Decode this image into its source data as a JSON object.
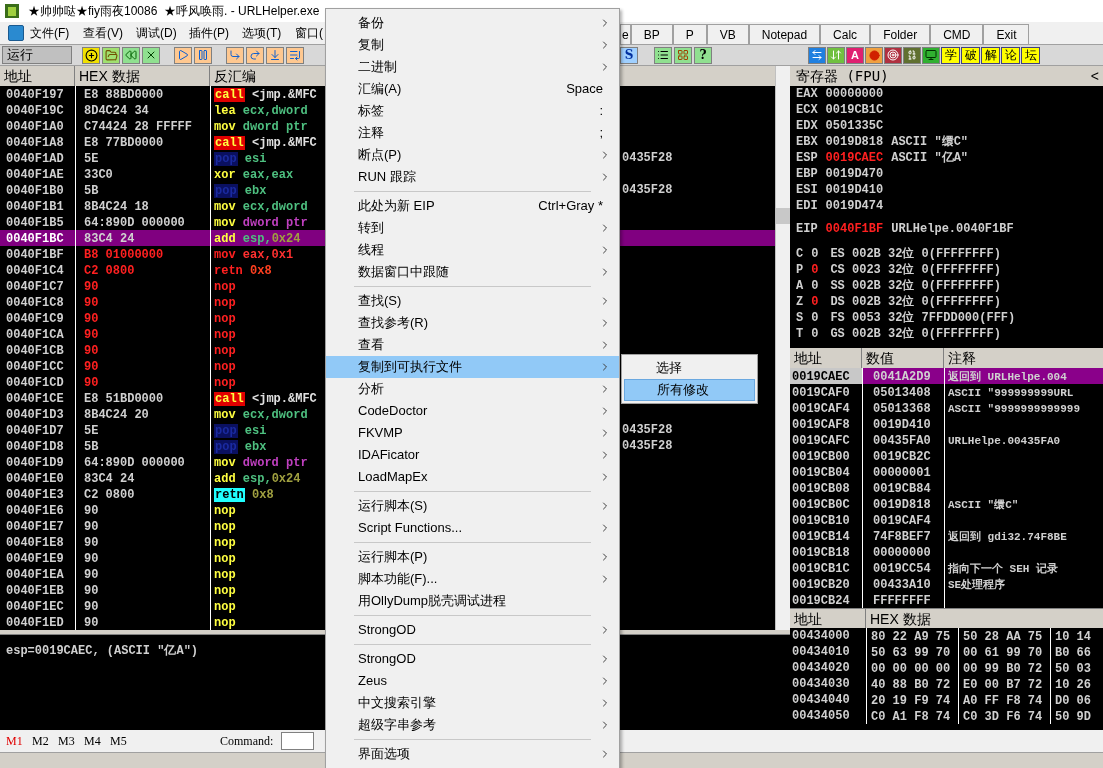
{
  "window": {
    "title": "★帅帅哒★fiy雨夜10086  ★呼风唤雨. - URLHelper.exe"
  },
  "menu_bar": [
    "文件(F)",
    "查看(V)",
    "调试(D)",
    "插件(P)",
    "选项(T)",
    "窗口("
  ],
  "tool_tabs": [
    "e",
    "BP",
    "P",
    "VB",
    "Notepad",
    "Calc",
    "Folder",
    "CMD",
    "Exit"
  ],
  "toolbar": {
    "run_label": "运行",
    "s_label": "S",
    "help_label": "?",
    "a_label": "A",
    "forum_chars": [
      "学",
      "破",
      "解",
      "论",
      "坛"
    ]
  },
  "disasm": {
    "columns": [
      "地址",
      "HEX 数据",
      "反汇编"
    ],
    "rows": [
      {
        "address": "0040F197",
        "hex": "E8 88BD0000",
        "mnemonic": "call",
        "kind": "call",
        "operands": [
          {
            "text": "<jmp.&MFC",
            "kind": "plain"
          }
        ],
        "selected": false,
        "modified": false
      },
      {
        "address": "0040F19C",
        "hex": "8D4C24 34",
        "mnemonic": "lea",
        "kind": "normal",
        "operands": [
          {
            "text": "ecx,dword",
            "kind": "reg"
          }
        ],
        "selected": false,
        "modified": false
      },
      {
        "address": "0040F1A0",
        "hex": "C74424 28 FFFFF",
        "mnemonic": "mov",
        "kind": "normal",
        "operands": [
          {
            "text": "dword ptr",
            "kind": "reg"
          }
        ],
        "selected": false,
        "modified": false
      },
      {
        "address": "0040F1A8",
        "hex": "E8 77BD0000",
        "mnemonic": "call",
        "kind": "call",
        "operands": [
          {
            "text": "<jmp.&MFC",
            "kind": "plain"
          }
        ],
        "selected": false,
        "modified": false
      },
      {
        "address": "0040F1AD",
        "hex": "5E",
        "mnemonic": "pop",
        "kind": "stack",
        "operands": [
          {
            "text": "esi",
            "kind": "reg"
          }
        ],
        "comment": "0435F28",
        "selected": false,
        "modified": false
      },
      {
        "address": "0040F1AE",
        "hex": "33C0",
        "mnemonic": "xor",
        "kind": "normal",
        "operands": [
          {
            "text": "eax,eax",
            "kind": "reg"
          }
        ],
        "selected": false,
        "modified": false
      },
      {
        "address": "0040F1B0",
        "hex": "5B",
        "mnemonic": "pop",
        "kind": "stack",
        "operands": [
          {
            "text": "ebx",
            "kind": "reg"
          }
        ],
        "comment": "0435F28",
        "selected": false,
        "modified": false
      },
      {
        "address": "0040F1B1",
        "hex": "8B4C24 18",
        "mnemonic": "mov",
        "kind": "normal",
        "operands": [
          {
            "text": "ecx,dword",
            "kind": "reg"
          }
        ],
        "selected": false,
        "modified": false
      },
      {
        "address": "0040F1B5",
        "hex": "64:890D 000000",
        "mnemonic": "mov",
        "kind": "normal",
        "operands": [
          {
            "text": "dword ptr",
            "kind": "mem"
          }
        ],
        "selected": false,
        "modified": false
      },
      {
        "address": "0040F1BC",
        "hex": "83C4 24",
        "mnemonic": "add",
        "kind": "normal",
        "operands": [
          {
            "text": "esp,",
            "kind": "reg"
          },
          {
            "text": "0x24",
            "kind": "const"
          }
        ],
        "selected": true,
        "modified": false
      },
      {
        "address": "0040F1BF",
        "hex": "B8 01000000",
        "mnemonic": "mov",
        "kind": "normal",
        "operands": [
          {
            "text": "eax,0x1",
            "kind": "reg"
          }
        ],
        "selected": false,
        "modified": true
      },
      {
        "address": "0040F1C4",
        "hex": "C2 0800",
        "mnemonic": "retn",
        "kind": "normal",
        "operands": [
          {
            "text": "0x8",
            "kind": "const"
          }
        ],
        "selected": false,
        "modified": true
      },
      {
        "address": "0040F1C7",
        "hex": "90",
        "mnemonic": "nop",
        "kind": "normal",
        "operands": [],
        "selected": false,
        "modified": true
      },
      {
        "address": "0040F1C8",
        "hex": "90",
        "mnemonic": "nop",
        "kind": "normal",
        "operands": [],
        "selected": false,
        "modified": true
      },
      {
        "address": "0040F1C9",
        "hex": "90",
        "mnemonic": "nop",
        "kind": "normal",
        "operands": [],
        "selected": false,
        "modified": true
      },
      {
        "address": "0040F1CA",
        "hex": "90",
        "mnemonic": "nop",
        "kind": "normal",
        "operands": [],
        "selected": false,
        "modified": true
      },
      {
        "address": "0040F1CB",
        "hex": "90",
        "mnemonic": "nop",
        "kind": "normal",
        "operands": [],
        "selected": false,
        "modified": true
      },
      {
        "address": "0040F1CC",
        "hex": "90",
        "mnemonic": "nop",
        "kind": "normal",
        "operands": [],
        "selected": false,
        "modified": true
      },
      {
        "address": "0040F1CD",
        "hex": "90",
        "mnemonic": "nop",
        "kind": "normal",
        "operands": [],
        "selected": false,
        "modified": true
      },
      {
        "address": "0040F1CE",
        "hex": "E8 51BD0000",
        "mnemonic": "call",
        "kind": "call",
        "operands": [
          {
            "text": "<jmp.&MFC",
            "kind": "plain"
          }
        ],
        "selected": false,
        "modified": false
      },
      {
        "address": "0040F1D3",
        "hex": "8B4C24 20",
        "mnemonic": "mov",
        "kind": "normal",
        "operands": [
          {
            "text": "ecx,dword",
            "kind": "reg"
          }
        ],
        "selected": false,
        "modified": false
      },
      {
        "address": "0040F1D7",
        "hex": "5E",
        "mnemonic": "pop",
        "kind": "stack",
        "operands": [
          {
            "text": "esi",
            "kind": "reg"
          }
        ],
        "comment": "0435F28",
        "selected": false,
        "modified": false
      },
      {
        "address": "0040F1D8",
        "hex": "5B",
        "mnemonic": "pop",
        "kind": "stack",
        "operands": [
          {
            "text": "ebx",
            "kind": "reg"
          }
        ],
        "comment": "0435F28",
        "selected": false,
        "modified": false
      },
      {
        "address": "0040F1D9",
        "hex": "64:890D 000000",
        "mnemonic": "mov",
        "kind": "normal",
        "operands": [
          {
            "text": "dword ptr",
            "kind": "mem"
          }
        ],
        "selected": false,
        "modified": false
      },
      {
        "address": "0040F1E0",
        "hex": "83C4 24",
        "mnemonic": "add",
        "kind": "normal",
        "operands": [
          {
            "text": "esp,",
            "kind": "reg"
          },
          {
            "text": "0x24",
            "kind": "const"
          }
        ],
        "selected": false,
        "modified": false
      },
      {
        "address": "0040F1E3",
        "hex": "C2 0800",
        "mnemonic": "retn",
        "kind": "ret",
        "operands": [
          {
            "text": "0x8",
            "kind": "const"
          }
        ],
        "selected": false,
        "modified": false
      },
      {
        "address": "0040F1E6",
        "hex": "90",
        "mnemonic": "nop",
        "kind": "normal",
        "operands": [],
        "selected": false,
        "modified": false
      },
      {
        "address": "0040F1E7",
        "hex": "90",
        "mnemonic": "nop",
        "kind": "normal",
        "operands": [],
        "selected": false,
        "modified": false
      },
      {
        "address": "0040F1E8",
        "hex": "90",
        "mnemonic": "nop",
        "kind": "normal",
        "operands": [],
        "selected": false,
        "modified": false
      },
      {
        "address": "0040F1E9",
        "hex": "90",
        "mnemonic": "nop",
        "kind": "normal",
        "operands": [],
        "selected": false,
        "modified": false
      },
      {
        "address": "0040F1EA",
        "hex": "90",
        "mnemonic": "nop",
        "kind": "normal",
        "operands": [],
        "selected": false,
        "modified": false
      },
      {
        "address": "0040F1EB",
        "hex": "90",
        "mnemonic": "nop",
        "kind": "normal",
        "operands": [],
        "selected": false,
        "modified": false
      },
      {
        "address": "0040F1EC",
        "hex": "90",
        "mnemonic": "nop",
        "kind": "normal",
        "operands": [],
        "selected": false,
        "modified": false
      },
      {
        "address": "0040F1ED",
        "hex": "90",
        "mnemonic": "nop",
        "kind": "normal",
        "operands": [],
        "selected": false,
        "modified": false
      }
    ]
  },
  "registers": {
    "title": "寄存器 (FPU)",
    "collapse": "<",
    "general": [
      {
        "name": "EAX",
        "value": "00000000",
        "changed": false
      },
      {
        "name": "ECX",
        "value": "0019CB1C",
        "changed": false
      },
      {
        "name": "EDX",
        "value": "0501335C",
        "changed": false
      },
      {
        "name": "EBX",
        "value": "0019D818",
        "changed": false,
        "comment": "ASCII \"缳C\""
      },
      {
        "name": "ESP",
        "value": "0019CAEC",
        "changed": true,
        "comment": "ASCII \"亿A\""
      },
      {
        "name": "EBP",
        "value": "0019D470",
        "changed": false
      },
      {
        "name": "ESI",
        "value": "0019D410",
        "changed": false
      },
      {
        "name": "EDI",
        "value": "0019D474",
        "changed": false
      }
    ],
    "eip": {
      "name": "EIP",
      "value": "0040F1BF",
      "changed": true,
      "comment": "URLHelpe.0040F1BF"
    },
    "flags": [
      {
        "flag": "C",
        "value": "0",
        "changed": false,
        "segment": "ES 002B 32位 0(FFFFFFFF)"
      },
      {
        "flag": "P",
        "value": "0",
        "changed": true,
        "segment": "CS 0023 32位 0(FFFFFFFF)"
      },
      {
        "flag": "A",
        "value": "0",
        "changed": false,
        "segment": "SS 002B 32位 0(FFFFFFFF)"
      },
      {
        "flag": "Z",
        "value": "0",
        "changed": true,
        "segment": "DS 002B 32位 0(FFFFFFFF)"
      },
      {
        "flag": "S",
        "value": "0",
        "changed": false,
        "segment": "FS 0053 32位 7FFDD000(FFF)"
      },
      {
        "flag": "T",
        "value": "0",
        "changed": false,
        "segment": "GS 002B 32位 0(FFFFFFFF)"
      }
    ]
  },
  "stack": {
    "columns": [
      "地址",
      "数值",
      "注释"
    ],
    "rows": [
      {
        "address": "0019CAEC",
        "value": "0041A2D9",
        "comment": "返回到 URLHelpe.004",
        "selected": true
      },
      {
        "address": "0019CAF0",
        "value": "05013408",
        "comment": "ASCII \"999999999URL",
        "selected": false
      },
      {
        "address": "0019CAF4",
        "value": "05013368",
        "comment": "ASCII \"9999999999999",
        "selected": false
      },
      {
        "address": "0019CAF8",
        "value": "0019D410",
        "selected": false
      },
      {
        "address": "0019CAFC",
        "value": "00435FA0",
        "comment": "URLHelpe.00435FA0",
        "selected": false
      },
      {
        "address": "0019CB00",
        "value": "0019CB2C",
        "selected": false
      },
      {
        "address": "0019CB04",
        "value": "00000001",
        "selected": false
      },
      {
        "address": "0019CB08",
        "value": "0019CB84",
        "selected": false
      },
      {
        "address": "0019CB0C",
        "value": "0019D818",
        "comment": "ASCII \"缳C\"",
        "selected": false
      },
      {
        "address": "0019CB10",
        "value": "0019CAF4",
        "selected": false
      },
      {
        "address": "0019CB14",
        "value": "74F8BEF7",
        "comment": "返回到 gdi32.74F8BE",
        "selected": false
      },
      {
        "address": "0019CB18",
        "value": "00000000",
        "selected": false
      },
      {
        "address": "0019CB1C",
        "value": "0019CC54",
        "comment": "指向下一个 SEH 记录",
        "selected": false
      },
      {
        "address": "0019CB20",
        "value": "00433A10",
        "comment": "SE处理程序",
        "selected": false
      },
      {
        "address": "0019CB24",
        "value": "FFFFFFFF",
        "selected": false
      }
    ]
  },
  "dump": {
    "columns": [
      "地址",
      "HEX 数据"
    ],
    "rows": [
      {
        "address": "00434000",
        "groups": [
          "80 22 A9 75",
          "50 28 AA 75",
          "10 14"
        ]
      },
      {
        "address": "00434010",
        "groups": [
          "50 63 99 70",
          "00 61 99 70",
          "B0 66"
        ]
      },
      {
        "address": "00434020",
        "groups": [
          "00 00 00 00",
          "00 99 B0 72",
          "50 03"
        ]
      },
      {
        "address": "00434030",
        "groups": [
          "40 88 B0 72",
          "E0 00 B7 72",
          "10 26"
        ]
      },
      {
        "address": "00434040",
        "groups": [
          "20 19 F9 74",
          "A0 FF F8 74",
          "D0 06"
        ]
      },
      {
        "address": "00434050",
        "groups": [
          "C0 A1 F8 74",
          "C0 3D F6 74",
          "50 9D"
        ]
      }
    ]
  },
  "info": "esp=0019CAEC, (ASCII \"亿A\")",
  "markers": [
    {
      "label": "M1",
      "selected": true
    },
    {
      "label": "M2",
      "selected": false
    },
    {
      "label": "M3",
      "selected": false
    },
    {
      "label": "M4",
      "selected": false
    },
    {
      "label": "M5",
      "selected": false
    }
  ],
  "command": {
    "label": "Command:"
  },
  "context_menu": {
    "items": [
      {
        "kind": "item",
        "label": "备份",
        "submenu": true,
        "selected": false
      },
      {
        "kind": "item",
        "label": "复制",
        "submenu": true,
        "selected": false
      },
      {
        "kind": "item",
        "label": "二进制",
        "submenu": true,
        "selected": false
      },
      {
        "kind": "item",
        "label": "汇编(A)",
        "shortcut": "Space",
        "submenu": false,
        "selected": false
      },
      {
        "kind": "item",
        "label": "标签",
        "shortcut": ":",
        "submenu": false,
        "selected": false
      },
      {
        "kind": "item",
        "label": "注释",
        "shortcut": ";",
        "submenu": false,
        "selected": false
      },
      {
        "kind": "item",
        "label": "断点(P)",
        "submenu": true,
        "selected": false
      },
      {
        "kind": "item",
        "label": "RUN 跟踪",
        "submenu": true,
        "selected": false
      },
      {
        "kind": "separator"
      },
      {
        "kind": "item",
        "label": "此处为新 EIP",
        "shortcut": "Ctrl+Gray *",
        "submenu": false,
        "selected": false
      },
      {
        "kind": "item",
        "label": "转到",
        "submenu": true,
        "selected": false
      },
      {
        "kind": "item",
        "label": "线程",
        "submenu": true,
        "selected": false
      },
      {
        "kind": "item",
        "label": "数据窗口中跟随",
        "submenu": true,
        "selected": false
      },
      {
        "kind": "separator"
      },
      {
        "kind": "item",
        "label": "查找(S)",
        "submenu": true,
        "selected": false
      },
      {
        "kind": "item",
        "label": "查找参考(R)",
        "submenu": true,
        "selected": false
      },
      {
        "kind": "item",
        "label": "查看",
        "submenu": true,
        "selected": false
      },
      {
        "kind": "item",
        "label": "复制到可执行文件",
        "submenu": true,
        "selected": true
      },
      {
        "kind": "item",
        "label": "分析",
        "submenu": true,
        "selected": false
      },
      {
        "kind": "item",
        "label": "CodeDoctor",
        "submenu": true,
        "selected": false
      },
      {
        "kind": "item",
        "label": "FKVMP",
        "submenu": true,
        "selected": false
      },
      {
        "kind": "item",
        "label": "IDAFicator",
        "submenu": true,
        "selected": false
      },
      {
        "kind": "item",
        "label": "LoadMapEx",
        "submenu": true,
        "selected": false
      },
      {
        "kind": "separator"
      },
      {
        "kind": "item",
        "label": "运行脚本(S)",
        "submenu": true,
        "selected": false
      },
      {
        "kind": "item",
        "label": "Script Functions...",
        "submenu": true,
        "selected": false
      },
      {
        "kind": "separator"
      },
      {
        "kind": "item",
        "label": "运行脚本(P)",
        "submenu": true,
        "selected": false
      },
      {
        "kind": "item",
        "label": "脚本功能(F)...",
        "submenu": true,
        "selected": false
      },
      {
        "kind": "item",
        "label": "用OllyDump脱壳调试进程",
        "submenu": false,
        "selected": false
      },
      {
        "kind": "separator"
      },
      {
        "kind": "item",
        "label": "StrongOD",
        "submenu": true,
        "selected": false
      },
      {
        "kind": "separator"
      },
      {
        "kind": "item",
        "label": "StrongOD",
        "submenu": true,
        "selected": false
      },
      {
        "kind": "item",
        "label": "Zeus",
        "submenu": true,
        "selected": false
      },
      {
        "kind": "item",
        "label": "中文搜索引擎",
        "submenu": true,
        "selected": false
      },
      {
        "kind": "item",
        "label": "超级字串参考",
        "submenu": true,
        "selected": false
      },
      {
        "kind": "separator"
      },
      {
        "kind": "item",
        "label": "界面选项",
        "submenu": true,
        "selected": false
      }
    ]
  },
  "submenu": {
    "items": [
      {
        "label": "选择",
        "selected": false
      },
      {
        "label": "所有修改",
        "selected": true
      }
    ]
  }
}
